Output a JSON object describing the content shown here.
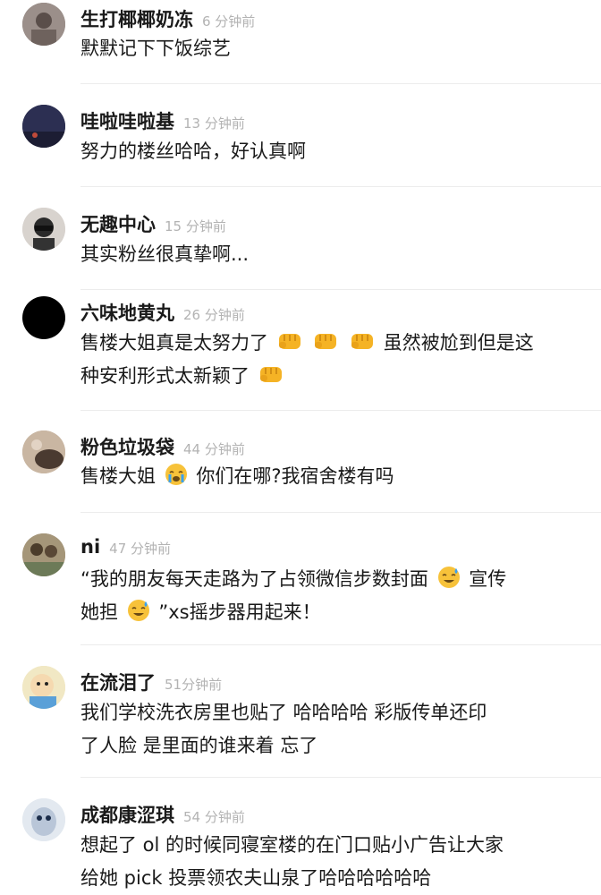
{
  "comments": [
    {
      "user": "生打椰椰奶冻",
      "time": "6 分钟前",
      "lines": [
        "默默记下下饭综艺"
      ]
    },
    {
      "user": "哇啦哇啦基",
      "time": "13 分钟前",
      "lines": [
        "努力的楼丝哈哈，好认真啊"
      ]
    },
    {
      "user": "无趣中心",
      "time": "15 分钟前",
      "lines": [
        "其实粉丝很真挚啊..."
      ]
    },
    {
      "user": "六味地黄丸",
      "time": "26 分钟前",
      "lines": [
        "售楼大姐真是太努力了",
        "虽然被尬到但是这",
        "种安利形式太新颖了"
      ]
    },
    {
      "user": "粉色垃圾袋",
      "time": "44 分钟前",
      "lines": [
        "售楼大姐",
        "你们在哪?我宿舍楼有吗"
      ]
    },
    {
      "user": "ni",
      "time": "47 分钟前",
      "lines": [
        "“我的朋友每天走路为了占领微信步数封面",
        "宣传",
        "她担",
        "”xs摇步器用起来！"
      ]
    },
    {
      "user": "在流泪了",
      "time": "51分钟前",
      "lines": [
        "我们学校洗衣房里也贴了 哈哈哈哈 彩版传单还印",
        "了人脸 是里面的谁来着 忘了"
      ]
    },
    {
      "user": "成都康涩琪",
      "time": "54 分钟前",
      "lines": [
        "想起了 ol 的时候同寝室楼的在门口贴小广告让大家",
        "给她 pick 投票领农夫山泉了哈哈哈哈哈哈"
      ]
    }
  ]
}
